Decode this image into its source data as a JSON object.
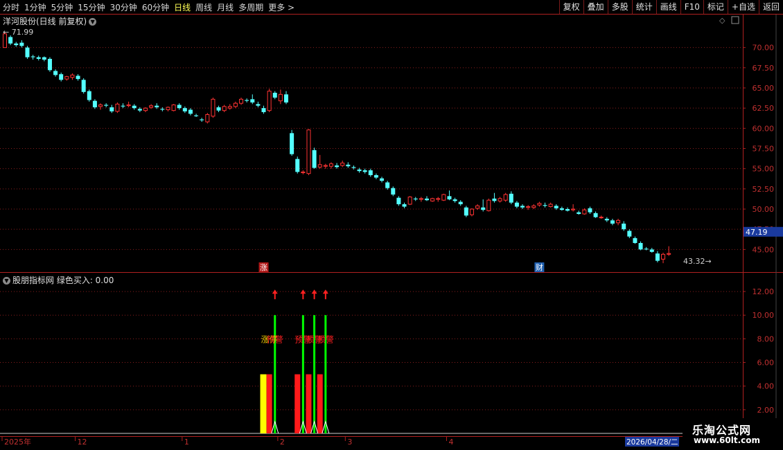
{
  "toolbar": {
    "periods": [
      "分时",
      "1分钟",
      "5分钟",
      "15分钟",
      "30分钟",
      "60分钟",
      "日线",
      "周线",
      "月线",
      "多周期",
      "更多 >"
    ],
    "active_index": 6,
    "right_buttons": [
      "复权",
      "叠加",
      "多股",
      "统计",
      "画线",
      "F10",
      "标记",
      "+自选",
      "返回"
    ]
  },
  "main_panel": {
    "title": "洋河股份(日线 前复权)",
    "high_label": "71.99",
    "low_label": "43.32",
    "current_price": "47.19",
    "markers": [
      {
        "label": "涨",
        "bg": "#b01818",
        "index": 46
      },
      {
        "label": "财",
        "bg": "#1e5fb0",
        "index": 95
      }
    ]
  },
  "indicator_panel": {
    "title": "股朋指标网  绿色买入: 0.00",
    "texts": [
      {
        "text": "涨停",
        "color": "#ffd700",
        "index": 47
      },
      {
        "text": "预警",
        "color": "#ff2020",
        "index": 48
      },
      {
        "text": "预警",
        "color": "#ff2020",
        "index": 53
      },
      {
        "text": "预警",
        "color": "#ff2020",
        "index": 55
      },
      {
        "text": "预警",
        "color": "#ff2020",
        "index": 57
      }
    ]
  },
  "x_axis": {
    "labels": [
      {
        "text": "2025年",
        "index": 0
      },
      {
        "text": "12",
        "index": 13
      },
      {
        "text": "1",
        "index": 32
      },
      {
        "text": "2",
        "index": 49
      },
      {
        "text": "3",
        "index": 61
      },
      {
        "text": "4",
        "index": 79
      }
    ],
    "date_box": "2026/04/28/二"
  },
  "logo": {
    "line1": "乐淘公式网",
    "line2": "www.60lt.com"
  },
  "colors": {
    "up": "#ff3333",
    "down": "#54ffff",
    "grid": "#8a1e1e",
    "axis": "#b02020",
    "cur_bg": "#1a3a9e"
  },
  "chart_data": [
    {
      "type": "candlestick",
      "title": "洋河股份(日线 前复权)",
      "ylim": [
        42.8,
        72.8
      ],
      "yticks": [
        45,
        47.5,
        50,
        52.5,
        55,
        57.5,
        60,
        62.5,
        65,
        67.5,
        70
      ],
      "ohlc": [
        [
          70.0,
          71.9,
          70.0,
          71.7
        ],
        [
          71.3,
          71.5,
          70.3,
          70.5
        ],
        [
          70.5,
          70.7,
          70.1,
          70.3
        ],
        [
          70.6,
          70.9,
          70.0,
          70.2
        ],
        [
          70.0,
          70.2,
          68.6,
          68.8
        ],
        [
          68.9,
          69.1,
          68.5,
          68.8
        ],
        [
          68.8,
          69.0,
          68.4,
          68.6
        ],
        [
          68.8,
          68.9,
          68.3,
          68.5
        ],
        [
          68.6,
          68.8,
          67.0,
          67.2
        ],
        [
          67.1,
          67.3,
          66.4,
          66.6
        ],
        [
          66.7,
          66.9,
          65.8,
          66.0
        ],
        [
          66.1,
          66.5,
          65.9,
          66.4
        ],
        [
          66.3,
          66.8,
          66.0,
          66.6
        ],
        [
          66.5,
          66.7,
          65.9,
          66.1
        ],
        [
          66.0,
          66.2,
          64.3,
          64.5
        ],
        [
          64.6,
          64.8,
          63.3,
          63.5
        ],
        [
          63.4,
          63.6,
          62.4,
          62.6
        ],
        [
          62.7,
          63.1,
          62.3,
          62.9
        ],
        [
          62.9,
          63.1,
          62.6,
          62.8
        ],
        [
          62.6,
          62.9,
          61.9,
          62.1
        ],
        [
          62.1,
          63.2,
          61.9,
          63.0
        ],
        [
          62.8,
          63.1,
          62.5,
          62.7
        ],
        [
          62.8,
          63.3,
          62.6,
          62.9
        ],
        [
          62.8,
          63.0,
          62.3,
          62.5
        ],
        [
          62.4,
          62.6,
          62.0,
          62.2
        ],
        [
          62.2,
          62.6,
          62.0,
          62.5
        ],
        [
          62.6,
          63.0,
          62.4,
          62.8
        ],
        [
          62.8,
          63.1,
          62.4,
          62.6
        ],
        [
          62.4,
          62.6,
          62.1,
          62.3
        ],
        [
          62.3,
          62.7,
          62.1,
          62.6
        ],
        [
          62.2,
          63.0,
          62.1,
          62.9
        ],
        [
          62.9,
          63.1,
          62.3,
          62.5
        ],
        [
          62.5,
          62.7,
          61.9,
          62.1
        ],
        [
          62.3,
          62.5,
          61.6,
          61.8
        ],
        [
          61.6,
          61.8,
          61.4,
          61.5
        ],
        [
          61.1,
          61.3,
          60.8,
          61.0
        ],
        [
          60.8,
          61.9,
          60.6,
          61.7
        ],
        [
          61.5,
          63.8,
          61.3,
          63.6
        ],
        [
          62.6,
          62.8,
          62.0,
          62.2
        ],
        [
          62.2,
          62.9,
          62.0,
          62.7
        ],
        [
          62.5,
          63.0,
          62.3,
          62.7
        ],
        [
          62.7,
          63.3,
          62.5,
          63.1
        ],
        [
          63.1,
          63.8,
          62.9,
          63.6
        ],
        [
          63.5,
          63.7,
          63.2,
          63.4
        ],
        [
          63.6,
          64.2,
          63.0,
          63.2
        ],
        [
          63.0,
          63.3,
          62.6,
          62.8
        ],
        [
          62.5,
          62.8,
          61.8,
          62.0
        ],
        [
          62.2,
          64.9,
          62.0,
          64.6
        ],
        [
          64.4,
          64.6,
          63.6,
          63.8
        ],
        [
          63.4,
          64.8,
          63.0,
          64.2
        ],
        [
          64.2,
          64.6,
          63.0,
          63.2
        ],
        [
          59.4,
          59.8,
          56.6,
          56.8
        ],
        [
          56.2,
          56.5,
          54.4,
          54.6
        ],
        [
          54.5,
          54.8,
          54.3,
          54.6
        ],
        [
          54.4,
          59.9,
          54.2,
          59.8
        ],
        [
          57.3,
          57.6,
          55.0,
          55.1
        ],
        [
          55.2,
          56.7,
          55.0,
          55.5
        ],
        [
          55.3,
          55.6,
          55.0,
          55.4
        ],
        [
          55.3,
          55.8,
          55.0,
          55.6
        ],
        [
          55.4,
          55.7,
          55.0,
          55.2
        ],
        [
          55.4,
          56.0,
          55.2,
          55.7
        ],
        [
          55.5,
          55.8,
          55.1,
          55.3
        ],
        [
          55.2,
          55.4,
          54.9,
          55.1
        ],
        [
          54.9,
          55.1,
          54.5,
          54.7
        ],
        [
          54.8,
          55.0,
          54.4,
          54.6
        ],
        [
          54.8,
          55.0,
          54.0,
          54.2
        ],
        [
          54.2,
          54.4,
          53.7,
          53.9
        ],
        [
          53.8,
          54.0,
          53.3,
          53.5
        ],
        [
          53.3,
          53.5,
          52.4,
          52.6
        ],
        [
          52.6,
          52.8,
          51.6,
          51.8
        ],
        [
          51.4,
          51.6,
          50.4,
          50.6
        ],
        [
          50.6,
          50.8,
          50.1,
          50.3
        ],
        [
          50.6,
          51.6,
          50.5,
          51.5
        ],
        [
          51.3,
          51.5,
          51.0,
          51.2
        ],
        [
          51.2,
          51.5,
          50.9,
          51.3
        ],
        [
          51.3,
          51.6,
          51.0,
          51.1
        ],
        [
          51.0,
          51.4,
          50.9,
          51.3
        ],
        [
          51.2,
          51.5,
          50.9,
          51.3
        ],
        [
          51.1,
          51.9,
          51.0,
          51.8
        ],
        [
          51.6,
          52.3,
          51.1,
          51.2
        ],
        [
          51.2,
          51.4,
          50.8,
          51.0
        ],
        [
          50.9,
          51.1,
          50.4,
          50.6
        ],
        [
          50.2,
          50.4,
          49.0,
          49.2
        ],
        [
          49.3,
          50.1,
          49.1,
          50.0
        ],
        [
          50.1,
          50.6,
          49.9,
          50.4
        ],
        [
          50.2,
          51.2,
          49.7,
          49.9
        ],
        [
          49.8,
          51.3,
          49.7,
          51.1
        ],
        [
          51.3,
          52.0,
          50.8,
          51.0
        ],
        [
          51.0,
          51.5,
          50.8,
          51.3
        ],
        [
          51.1,
          52.0,
          50.9,
          51.8
        ],
        [
          51.9,
          52.2,
          50.6,
          50.8
        ],
        [
          50.8,
          51.0,
          50.1,
          50.3
        ],
        [
          50.4,
          50.6,
          50.0,
          50.2
        ],
        [
          50.2,
          50.5,
          49.9,
          50.3
        ],
        [
          50.2,
          50.6,
          50.0,
          50.4
        ],
        [
          50.5,
          50.9,
          50.3,
          50.7
        ],
        [
          50.5,
          50.8,
          50.2,
          50.4
        ],
        [
          50.3,
          50.8,
          50.2,
          50.6
        ],
        [
          50.4,
          50.6,
          49.9,
          50.1
        ],
        [
          50.1,
          50.3,
          49.8,
          49.9
        ],
        [
          50.0,
          50.2,
          49.7,
          49.8
        ],
        [
          49.9,
          50.6,
          49.7,
          50.0
        ],
        [
          49.6,
          49.8,
          49.3,
          49.4
        ],
        [
          49.4,
          50.1,
          49.3,
          49.9
        ],
        [
          50.1,
          50.3,
          49.4,
          49.6
        ],
        [
          49.5,
          49.7,
          48.9,
          49.0
        ],
        [
          49.0,
          49.2,
          48.8,
          49.0
        ],
        [
          48.8,
          49.0,
          48.4,
          48.6
        ],
        [
          48.6,
          48.8,
          48.0,
          48.2
        ],
        [
          48.3,
          48.8,
          48.0,
          48.6
        ],
        [
          48.2,
          48.5,
          47.3,
          47.5
        ],
        [
          47.3,
          47.5,
          46.4,
          46.6
        ],
        [
          46.4,
          46.6,
          45.7,
          45.8
        ],
        [
          45.8,
          46.0,
          44.9,
          45.0
        ],
        [
          45.1,
          45.3,
          44.9,
          45.0
        ],
        [
          45.0,
          45.2,
          44.6,
          44.7
        ],
        [
          44.5,
          44.8,
          43.4,
          43.6
        ],
        [
          43.8,
          44.6,
          43.3,
          44.4
        ],
        [
          44.4,
          45.4,
          44.2,
          44.5
        ]
      ]
    },
    {
      "type": "bar",
      "title": "股朋指标网  绿色买入: 0.00",
      "ylim": [
        0,
        13
      ],
      "yticks": [
        2,
        4,
        6,
        8,
        10,
        12
      ],
      "yellow_bars": [
        {
          "index": 46,
          "value": 5
        }
      ],
      "red_bars": [
        {
          "index": 47,
          "value": 5
        },
        {
          "index": 52,
          "value": 5
        },
        {
          "index": 54,
          "value": 5
        },
        {
          "index": 56,
          "value": 5
        }
      ],
      "green_lines": [
        {
          "index": 48,
          "value": 10
        },
        {
          "index": 53,
          "value": 10
        },
        {
          "index": 55,
          "value": 10
        },
        {
          "index": 57,
          "value": 10
        }
      ],
      "arrows": [
        {
          "index": 48,
          "value": 11.7
        },
        {
          "index": 53,
          "value": 11.7
        },
        {
          "index": 55,
          "value": 11.7
        },
        {
          "index": 57,
          "value": 11.7
        }
      ],
      "peaks": [
        {
          "index": 48,
          "value": 1
        },
        {
          "index": 53,
          "value": 1
        },
        {
          "index": 55,
          "value": 1
        },
        {
          "index": 57,
          "value": 1
        }
      ]
    }
  ]
}
